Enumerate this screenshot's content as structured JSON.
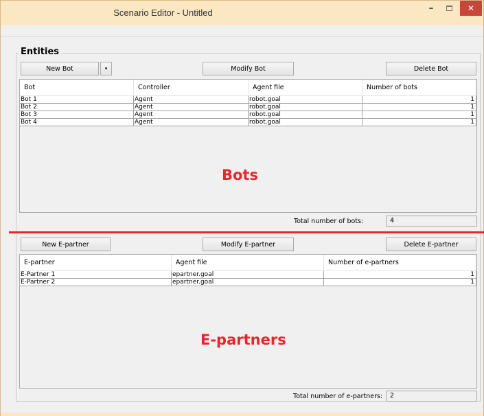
{
  "window": {
    "title": "Scenario Editor - Untitled",
    "minimize_glyph": "–",
    "close_glyph": "✕"
  },
  "entities": {
    "title": "Entities"
  },
  "bots": {
    "new_label": "New Bot",
    "dropdown_glyph": "▾",
    "modify_label": "Modify Bot",
    "delete_label": "Delete Bot",
    "columns": [
      "Bot",
      "Controller",
      "Agent file",
      "Number of bots"
    ],
    "rows": [
      [
        "Bot 1",
        "Agent",
        "robot.goal",
        "1"
      ],
      [
        "Bot 2",
        "Agent",
        "robot.goal",
        "1"
      ],
      [
        "Bot 3",
        "Agent",
        "robot.goal",
        "1"
      ],
      [
        "Bot 4",
        "Agent",
        "robot.goal",
        "1"
      ]
    ],
    "overlay_label": "Bots",
    "total_label": "Total number of bots:",
    "total_value": "4"
  },
  "epartners": {
    "new_label": "New E-partner",
    "modify_label": "Modify E-partner",
    "delete_label": "Delete E-partner",
    "columns": [
      "E-partner",
      "Agent file",
      "Number of e-partners"
    ],
    "rows": [
      [
        "E-Partner 1",
        "epartner.goal",
        "1"
      ],
      [
        "E-Partner 2",
        "epartner.goal",
        "1"
      ]
    ],
    "overlay_label": "E-partners",
    "total_label": "Total number of e-partners:",
    "total_value": "2"
  },
  "colors": {
    "titlebar": "#fbe7c2",
    "close_button": "#c7463b",
    "annotation_red": "#e8262a"
  }
}
